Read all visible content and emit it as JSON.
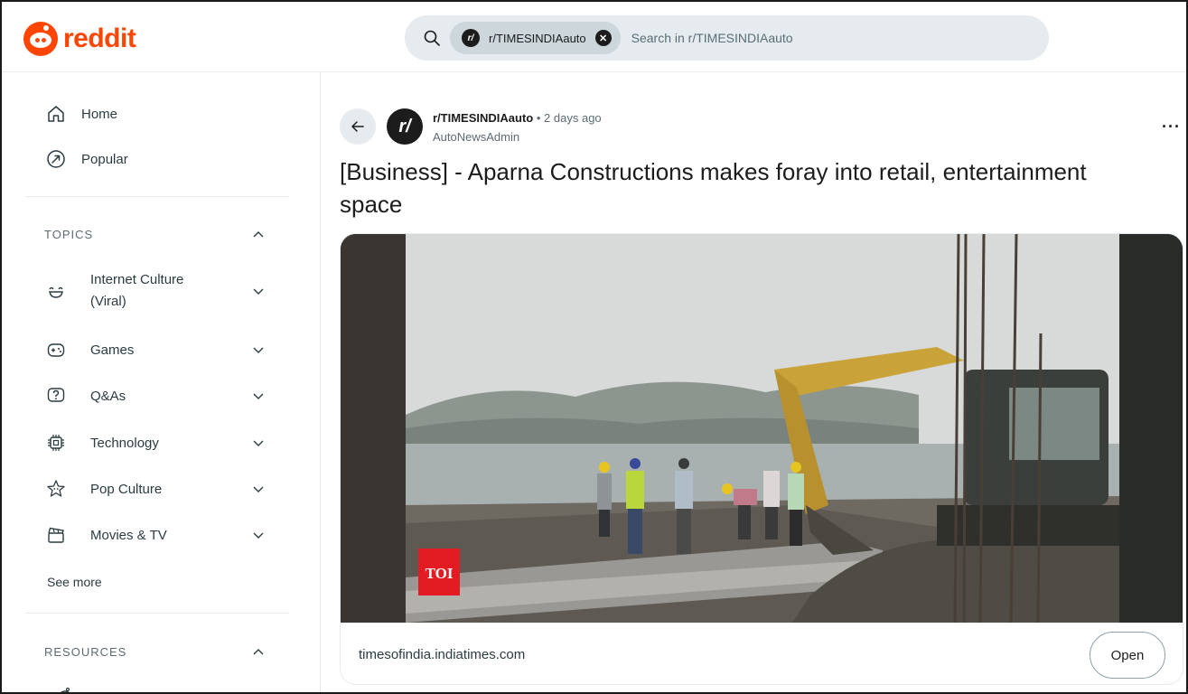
{
  "brand": {
    "name": "reddit",
    "color": "#ff4500"
  },
  "search": {
    "chip_label": "r/TIMESINDIAauto",
    "chip_avatar": "r/",
    "placeholder": "Search in r/TIMESINDIAauto"
  },
  "sidebar": {
    "nav": [
      {
        "label": "Home",
        "icon": "home-icon"
      },
      {
        "label": "Popular",
        "icon": "popular-icon"
      }
    ],
    "topics_label": "TOPICS",
    "topics": [
      {
        "label": "Internet Culture (Viral)",
        "icon": "internet-culture-icon"
      },
      {
        "label": "Games",
        "icon": "games-icon"
      },
      {
        "label": "Q&As",
        "icon": "qa-icon"
      },
      {
        "label": "Technology",
        "icon": "technology-icon"
      },
      {
        "label": "Pop Culture",
        "icon": "pop-culture-icon"
      },
      {
        "label": "Movies & TV",
        "icon": "movies-tv-icon"
      }
    ],
    "see_more": "See more",
    "resources_label": "RESOURCES"
  },
  "post": {
    "subreddit": "r/TIMESINDIAauto",
    "subreddit_avatar": "r/",
    "separator": "•",
    "time": "2 days ago",
    "author": "AutoNewsAdmin",
    "more": "···",
    "title": "[Business] - Aparna Constructions makes foray into retail, entertainment space",
    "image_badge": "TOI",
    "link_domain": "timesofindia.indiatimes.com",
    "open_label": "Open"
  }
}
